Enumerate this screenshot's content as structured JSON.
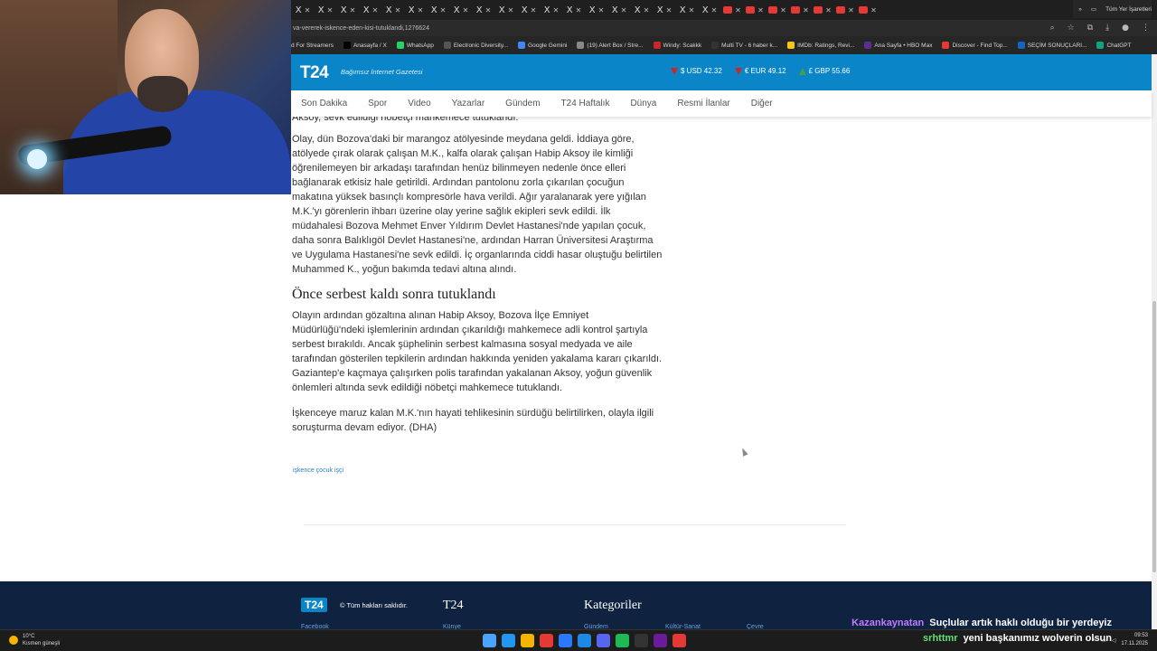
{
  "browser": {
    "tab_glyph": "X",
    "url": "va-vererek-iskence-eden-kisi-tutuklandi,1276624",
    "bookmarks": [
      {
        "label": "d For Streamers",
        "color": "#6441a5"
      },
      {
        "label": "Anasayfa / X",
        "color": "#000000"
      },
      {
        "label": "WhatsApp",
        "color": "#25d366"
      },
      {
        "label": "Electronic Diversity...",
        "color": "#555555"
      },
      {
        "label": "Google Gemini",
        "color": "#4285f4"
      },
      {
        "label": "(19) Alert Box / Stre...",
        "color": "#888888"
      },
      {
        "label": "Windy: Scakkk",
        "color": "#c62828"
      },
      {
        "label": "Multi TV - 6 haber k...",
        "color": "#333333"
      },
      {
        "label": "IMDb: Ratings, Revi...",
        "color": "#f5c518"
      },
      {
        "label": "Ana Sayfa • HBO Max",
        "color": "#5b2d91"
      },
      {
        "label": "Discover - Find Top...",
        "color": "#e53935"
      },
      {
        "label": "SEÇİM SONUÇLARI...",
        "color": "#1565c0"
      },
      {
        "label": "ChatGPT",
        "color": "#10a37f"
      }
    ],
    "bookmarks_more": "»",
    "all_bookmarks": "Tüm Yer İşaretleri"
  },
  "site": {
    "logo": "T24",
    "tagline": "Bağımsız İnternet Gazetesi",
    "rates": [
      {
        "symbol": "$",
        "label": "USD 42.32",
        "trend": "down"
      },
      {
        "symbol": "€",
        "label": "EUR 49.12",
        "trend": "down"
      },
      {
        "symbol": "£",
        "label": "GBP 55.66",
        "trend": "up"
      }
    ],
    "nav": [
      "Son Dakika",
      "Spor",
      "Video",
      "Yazarlar",
      "Gündem",
      "T24 Haftalık",
      "Dünya",
      "Resmi İlanlar",
      "Diğer"
    ]
  },
  "article": {
    "partial_line": "Aksoy, sevk edildiği nöbetçi mahkemece tutuklandı.",
    "p1": "Olay, dün Bozova'daki bir marangoz atölyesinde meydana geldi. İddiaya göre, atölyede çırak olarak çalışan M.K., kalfa olarak çalışan Habip Aksoy ile kimliği öğrenilemeyen bir arkadaşı tarafından henüz bilinmeyen nedenle önce elleri bağlanarak etkisiz hale getirildi. Ardından pantolonu zorla çıkarılan çocuğun makatına yüksek basınçlı kompresörle hava verildi. Ağır yaralanarak yere yığılan M.K.'yı görenlerin ihbarı üzerine olay yerine sağlık ekipleri sevk edildi. İlk müdahalesi Bozova Mehmet Enver Yıldırım Devlet Hastanesi'nde yapılan çocuk, daha sonra Balıklıgöl Devlet Hastanesi'ne, ardından Harran Üniversitesi Araştırma ve Uygulama Hastanesi'ne sevk edildi. İç organlarında ciddi hasar oluştuğu belirtilen Muhammed K., yoğun bakımda tedavi altına alındı.",
    "h2": "Önce serbest kaldı sonra tutuklandı",
    "p2": "Olayın ardından gözaltına alınan Habip Aksoy, Bozova İlçe Emniyet Müdürlüğü'ndeki işlemlerinin ardından çıkarıldığı mahkemece adli kontrol şartıyla serbest bırakıldı. Ancak şüphelinin serbest kalmasına sosyal medyada ve aile tarafından gösterilen tepkilerin ardından hakkında yeniden yakalama kararı çıkarıldı. Gaziantep'e kaçmaya çalışırken polis tarafından yakalanan Aksoy, yoğun güvenlik önlemleri altında sevk edildiği nöbetçi mahkemece tutuklandı.",
    "p3": "İşkenceye maruz kalan M.K.'nın hayati tehlikesinin sürdüğü belirtilirken, olayla ilgili soruşturma devam ediyor. (DHA)",
    "tags": "işkence çocuk işçi"
  },
  "footer": {
    "logo": "T24",
    "copyright": "© Tüm hakları saklıdır.",
    "col1": "T24",
    "col2": "Kategoriler",
    "links": [
      "Facebook",
      "Künye",
      "Gündem",
      "Kültür-Sanat",
      "Çevre"
    ]
  },
  "chat": [
    {
      "user": "Kazankaynatan",
      "message": "Suçlular artık haklı olduğu bir yerdeyiz"
    },
    {
      "user": "srhttmr",
      "message": "yeni başkanımız wolverin olsun"
    }
  ],
  "taskbar": {
    "temp": "10°C",
    "weather": "Kısmen güneşli",
    "time": "09:53",
    "date": "17.11.2025",
    "app_colors": [
      "#4aa3ff",
      "#2196f3",
      "#f4b400",
      "#e53935",
      "#2979ff",
      "#1e88e5",
      "#5865f2",
      "#1db954",
      "#333333",
      "#6a1b9a",
      "#e53935"
    ]
  }
}
